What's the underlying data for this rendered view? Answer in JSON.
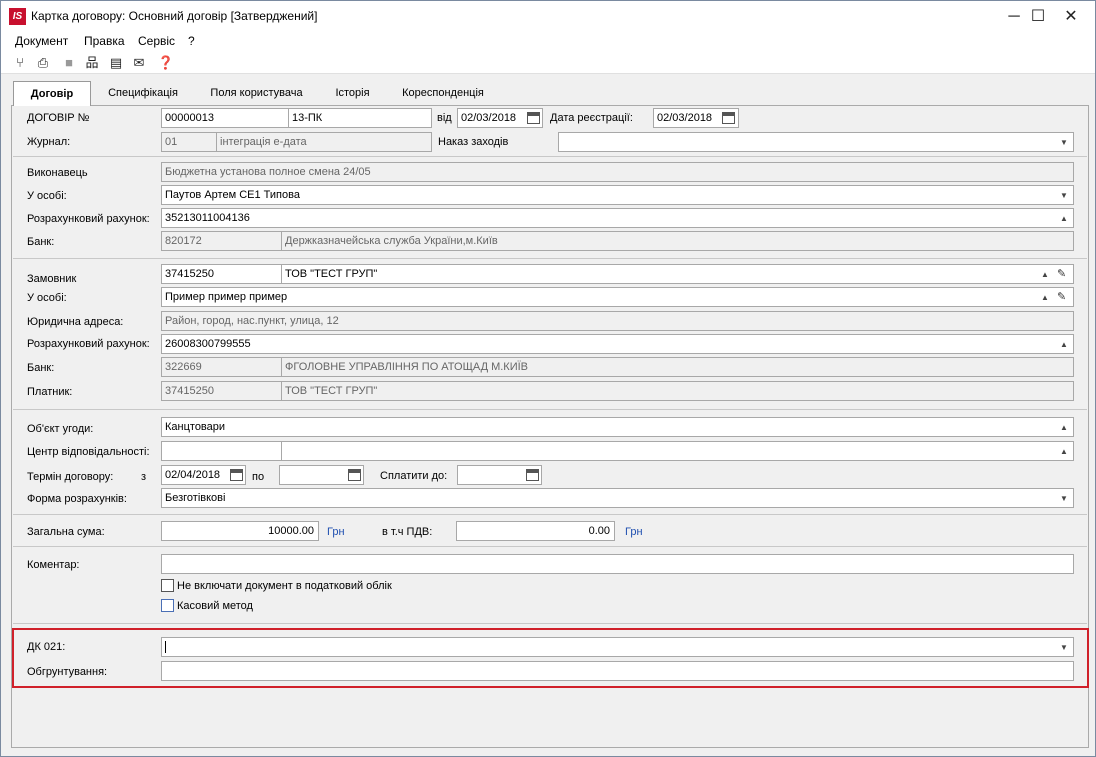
{
  "window": {
    "app_icon": "IS",
    "title": "Картка договору: Основний договір [Затверджений]",
    "minimize": "─",
    "maximize": "☐",
    "close": "✕"
  },
  "menu": [
    "Документ",
    "Правка",
    "Сервіс",
    "?"
  ],
  "toolbar": {
    "icons": [
      "approve-icon",
      "print-icon",
      "stop-icon",
      "structure-icon",
      "page-icon",
      "mail-icon",
      "help-icon"
    ]
  },
  "tabs": [
    "Договір",
    "Специфікація",
    "Поля користувача",
    "Історія",
    "Кореспонденція"
  ],
  "contract": {
    "number_label": "ДОГОВІР №",
    "number": "00000013",
    "code": "13-ПК",
    "from_label": "від",
    "from_date": "02/03/2018",
    "reg_label": "Дата реєстрації:",
    "reg_date": "02/03/2018",
    "journal_label": "Журнал:",
    "journal_code": "01",
    "journal_name": "інтеграція е-дата",
    "order_label": "Наказ заходів",
    "order_value": ""
  },
  "executor": {
    "label": "Виконавець",
    "name": "Бюджетна установа полное смена 24/05",
    "person_label": "У особі:",
    "person": "Паутов Артем СЕ1 Типова",
    "account_label": "Розрахунковий рахунок:",
    "account": "35213011004136",
    "bank_label": "Банк:",
    "bank_code": "820172",
    "bank_name": "Держказначейська служба України,м.Київ"
  },
  "customer": {
    "label": "Замовник",
    "code": "37415250",
    "name": "ТОВ \"ТЕСТ ГРУП\"",
    "person_label": "У особі:",
    "person": "Пример пример пример",
    "address_label": "Юридична адреса:",
    "address": "Район, город, нас.пункт, улица, 12",
    "account_label": "Розрахунковий рахунок:",
    "account": "26008300799555",
    "bank_label": "Банк:",
    "bank_code": "322669",
    "bank_name": "ФГОЛОВНЕ УПРАВЛІННЯ ПО  АТОЩАД М.КИЇВ",
    "payer_label": "Платник:",
    "payer_code": "37415250",
    "payer_name": "ТОВ \"ТЕСТ ГРУП\""
  },
  "deal": {
    "object_label": "Об'єкт угоди:",
    "object": "Канцтовари",
    "center_label": "Центр відповідальності:",
    "center_code": "",
    "center_name": "",
    "term_label": "Термін договору:",
    "from_label": "з",
    "from": "02/04/2018",
    "to_label": "по",
    "to": "",
    "pay_label": "Сплатити до:",
    "pay_date": "",
    "form_label": "Форма розрахунків:",
    "form": "Безготівкові"
  },
  "totals": {
    "sum_label": "Загальна сума:",
    "sum": "10000.00",
    "cur1": "Грн",
    "vat_label": "в т.ч ПДВ:",
    "vat": "0.00",
    "cur2": "Грн"
  },
  "comment": {
    "label": "Коментар:",
    "value": "",
    "chk1": "Не включати документ в податковий облік",
    "chk2": "Касовий метод"
  },
  "dk": {
    "label": "ДК 021:",
    "value": "",
    "justify_label": "Обгрунтування:",
    "justify": ""
  }
}
